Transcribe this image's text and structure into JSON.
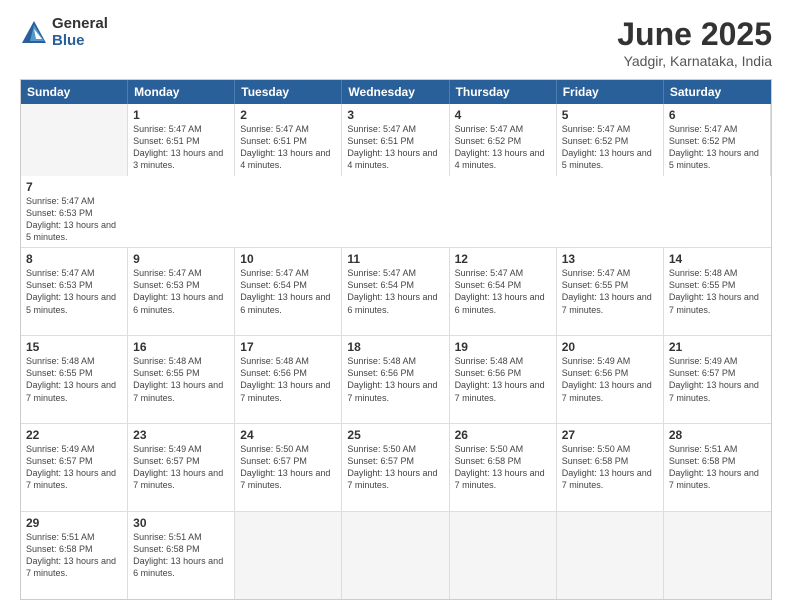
{
  "logo": {
    "general": "General",
    "blue": "Blue"
  },
  "title": "June 2025",
  "subtitle": "Yadgir, Karnataka, India",
  "headers": [
    "Sunday",
    "Monday",
    "Tuesday",
    "Wednesday",
    "Thursday",
    "Friday",
    "Saturday"
  ],
  "rows": [
    [
      {
        "day": "",
        "empty": true
      },
      {
        "day": "2",
        "sunrise": "Sunrise: 5:47 AM",
        "sunset": "Sunset: 6:51 PM",
        "daylight": "Daylight: 13 hours and 4 minutes."
      },
      {
        "day": "3",
        "sunrise": "Sunrise: 5:47 AM",
        "sunset": "Sunset: 6:51 PM",
        "daylight": "Daylight: 13 hours and 4 minutes."
      },
      {
        "day": "4",
        "sunrise": "Sunrise: 5:47 AM",
        "sunset": "Sunset: 6:52 PM",
        "daylight": "Daylight: 13 hours and 4 minutes."
      },
      {
        "day": "5",
        "sunrise": "Sunrise: 5:47 AM",
        "sunset": "Sunset: 6:52 PM",
        "daylight": "Daylight: 13 hours and 5 minutes."
      },
      {
        "day": "6",
        "sunrise": "Sunrise: 5:47 AM",
        "sunset": "Sunset: 6:52 PM",
        "daylight": "Daylight: 13 hours and 5 minutes."
      },
      {
        "day": "7",
        "sunrise": "Sunrise: 5:47 AM",
        "sunset": "Sunset: 6:53 PM",
        "daylight": "Daylight: 13 hours and 5 minutes."
      }
    ],
    [
      {
        "day": "8",
        "sunrise": "Sunrise: 5:47 AM",
        "sunset": "Sunset: 6:53 PM",
        "daylight": "Daylight: 13 hours and 5 minutes."
      },
      {
        "day": "9",
        "sunrise": "Sunrise: 5:47 AM",
        "sunset": "Sunset: 6:53 PM",
        "daylight": "Daylight: 13 hours and 6 minutes."
      },
      {
        "day": "10",
        "sunrise": "Sunrise: 5:47 AM",
        "sunset": "Sunset: 6:54 PM",
        "daylight": "Daylight: 13 hours and 6 minutes."
      },
      {
        "day": "11",
        "sunrise": "Sunrise: 5:47 AM",
        "sunset": "Sunset: 6:54 PM",
        "daylight": "Daylight: 13 hours and 6 minutes."
      },
      {
        "day": "12",
        "sunrise": "Sunrise: 5:47 AM",
        "sunset": "Sunset: 6:54 PM",
        "daylight": "Daylight: 13 hours and 6 minutes."
      },
      {
        "day": "13",
        "sunrise": "Sunrise: 5:47 AM",
        "sunset": "Sunset: 6:55 PM",
        "daylight": "Daylight: 13 hours and 7 minutes."
      },
      {
        "day": "14",
        "sunrise": "Sunrise: 5:48 AM",
        "sunset": "Sunset: 6:55 PM",
        "daylight": "Daylight: 13 hours and 7 minutes."
      }
    ],
    [
      {
        "day": "15",
        "sunrise": "Sunrise: 5:48 AM",
        "sunset": "Sunset: 6:55 PM",
        "daylight": "Daylight: 13 hours and 7 minutes."
      },
      {
        "day": "16",
        "sunrise": "Sunrise: 5:48 AM",
        "sunset": "Sunset: 6:55 PM",
        "daylight": "Daylight: 13 hours and 7 minutes."
      },
      {
        "day": "17",
        "sunrise": "Sunrise: 5:48 AM",
        "sunset": "Sunset: 6:56 PM",
        "daylight": "Daylight: 13 hours and 7 minutes."
      },
      {
        "day": "18",
        "sunrise": "Sunrise: 5:48 AM",
        "sunset": "Sunset: 6:56 PM",
        "daylight": "Daylight: 13 hours and 7 minutes."
      },
      {
        "day": "19",
        "sunrise": "Sunrise: 5:48 AM",
        "sunset": "Sunset: 6:56 PM",
        "daylight": "Daylight: 13 hours and 7 minutes."
      },
      {
        "day": "20",
        "sunrise": "Sunrise: 5:49 AM",
        "sunset": "Sunset: 6:56 PM",
        "daylight": "Daylight: 13 hours and 7 minutes."
      },
      {
        "day": "21",
        "sunrise": "Sunrise: 5:49 AM",
        "sunset": "Sunset: 6:57 PM",
        "daylight": "Daylight: 13 hours and 7 minutes."
      }
    ],
    [
      {
        "day": "22",
        "sunrise": "Sunrise: 5:49 AM",
        "sunset": "Sunset: 6:57 PM",
        "daylight": "Daylight: 13 hours and 7 minutes."
      },
      {
        "day": "23",
        "sunrise": "Sunrise: 5:49 AM",
        "sunset": "Sunset: 6:57 PM",
        "daylight": "Daylight: 13 hours and 7 minutes."
      },
      {
        "day": "24",
        "sunrise": "Sunrise: 5:50 AM",
        "sunset": "Sunset: 6:57 PM",
        "daylight": "Daylight: 13 hours and 7 minutes."
      },
      {
        "day": "25",
        "sunrise": "Sunrise: 5:50 AM",
        "sunset": "Sunset: 6:57 PM",
        "daylight": "Daylight: 13 hours and 7 minutes."
      },
      {
        "day": "26",
        "sunrise": "Sunrise: 5:50 AM",
        "sunset": "Sunset: 6:58 PM",
        "daylight": "Daylight: 13 hours and 7 minutes."
      },
      {
        "day": "27",
        "sunrise": "Sunrise: 5:50 AM",
        "sunset": "Sunset: 6:58 PM",
        "daylight": "Daylight: 13 hours and 7 minutes."
      },
      {
        "day": "28",
        "sunrise": "Sunrise: 5:51 AM",
        "sunset": "Sunset: 6:58 PM",
        "daylight": "Daylight: 13 hours and 7 minutes."
      }
    ],
    [
      {
        "day": "29",
        "sunrise": "Sunrise: 5:51 AM",
        "sunset": "Sunset: 6:58 PM",
        "daylight": "Daylight: 13 hours and 7 minutes."
      },
      {
        "day": "30",
        "sunrise": "Sunrise: 5:51 AM",
        "sunset": "Sunset: 6:58 PM",
        "daylight": "Daylight: 13 hours and 6 minutes."
      },
      {
        "day": "",
        "empty": true
      },
      {
        "day": "",
        "empty": true
      },
      {
        "day": "",
        "empty": true
      },
      {
        "day": "",
        "empty": true
      },
      {
        "day": "",
        "empty": true
      }
    ]
  ],
  "row0_day1": {
    "day": "1",
    "sunrise": "Sunrise: 5:47 AM",
    "sunset": "Sunset: 6:51 PM",
    "daylight": "Daylight: 13 hours and 3 minutes."
  }
}
